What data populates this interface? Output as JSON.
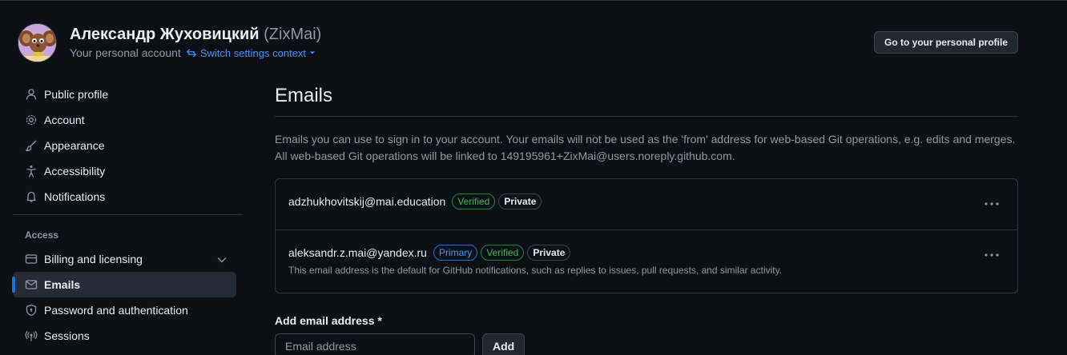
{
  "header": {
    "display_name": "Александр Жуховицкий",
    "login": "(ZixMai)",
    "account_label": "Your personal account",
    "switch_context": "Switch settings context",
    "profile_button": "Go to your personal profile"
  },
  "sidebar": {
    "items": [
      {
        "label": "Public profile",
        "icon": "person-icon"
      },
      {
        "label": "Account",
        "icon": "gear-icon"
      },
      {
        "label": "Appearance",
        "icon": "paintbrush-icon"
      },
      {
        "label": "Accessibility",
        "icon": "accessibility-icon"
      },
      {
        "label": "Notifications",
        "icon": "bell-icon"
      }
    ],
    "access_title": "Access",
    "access_items": [
      {
        "label": "Billing and licensing",
        "icon": "credit-card-icon"
      },
      {
        "label": "Emails",
        "icon": "mail-icon",
        "active": true
      },
      {
        "label": "Password and authentication",
        "icon": "shield-lock-icon"
      },
      {
        "label": "Sessions",
        "icon": "broadcast-icon"
      }
    ]
  },
  "main": {
    "title": "Emails",
    "description": "Emails you can use to sign in to your account. Your emails will not be used as the 'from' address for web-based Git operations, e.g. edits and merges. All web-based Git operations will be linked to 149195961+ZixMai@users.noreply.github.com.",
    "emails": [
      {
        "address": "adzhukhovitskij@mai.education",
        "verified": "Verified",
        "private": "Private"
      },
      {
        "address": "aleksandr.z.mai@yandex.ru",
        "primary": "Primary",
        "verified": "Verified",
        "private": "Private",
        "note": "This email address is the default for GitHub notifications, such as replies to issues, pull requests, and similar activity."
      }
    ],
    "add_label": "Add email address *",
    "add_placeholder": "Email address",
    "add_button": "Add"
  },
  "colors": {
    "background": "#0d1117",
    "accent": "#4493f8",
    "verified": "#3fb950",
    "active_indicator": "#1f6feb"
  }
}
